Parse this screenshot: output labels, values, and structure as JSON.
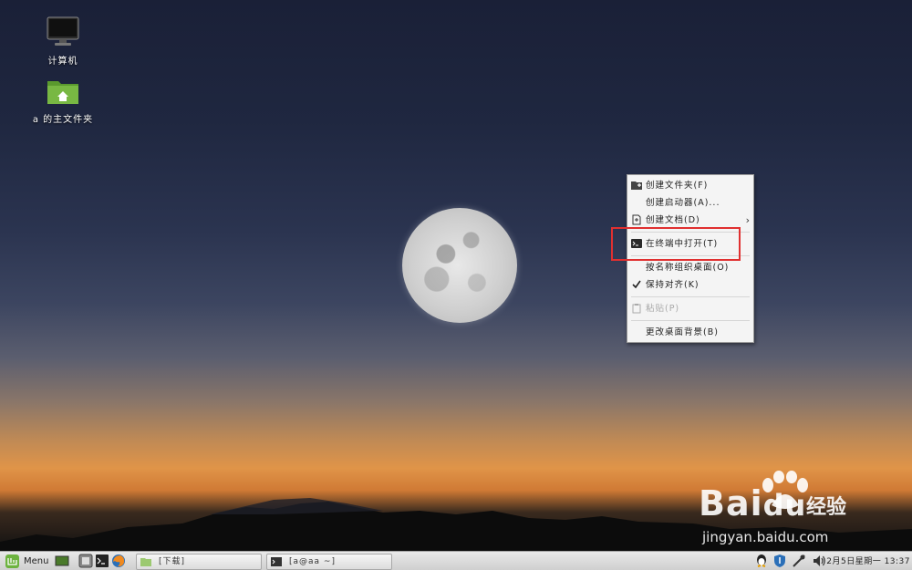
{
  "desktop_icons": [
    {
      "label": "计算机",
      "icon": "computer-icon"
    },
    {
      "label": "a 的主文件夹",
      "icon": "home-folder-icon"
    }
  ],
  "context_menu": {
    "items": [
      {
        "label": "创建文件夹(F)",
        "icon": "folder-new-icon",
        "enabled": true
      },
      {
        "label": "创建启动器(A)...",
        "icon": "",
        "enabled": true
      },
      {
        "label": "创建文档(D)",
        "icon": "document-new-icon",
        "enabled": true,
        "submenu": true
      },
      {
        "label": "在终端中打开(T)",
        "icon": "terminal-icon",
        "enabled": true,
        "highlighted": true
      },
      {
        "label": "按名称组织桌面(O)",
        "icon": "",
        "enabled": true
      },
      {
        "label": "保持对齐(K)",
        "icon": "check-icon",
        "enabled": true,
        "checked": true
      },
      {
        "label": "粘贴(P)",
        "icon": "paste-icon",
        "enabled": false
      },
      {
        "label": "更改桌面背景(B)",
        "icon": "",
        "enabled": true
      }
    ],
    "submenu_arrow": "›",
    "highlight_color": "#e03030"
  },
  "watermark": {
    "brand": "Bai",
    "brand_suffix": "du",
    "cn": "经验",
    "url": "jingyan.baidu.com"
  },
  "taskbar": {
    "menu_label": "Menu",
    "tasks": [
      {
        "label": "[下载]",
        "icon": "folder-icon"
      },
      {
        "label": "[a@aa ~]",
        "icon": "terminal-icon"
      }
    ],
    "clock": "2月5日星期一 13:37"
  },
  "colors": {
    "accent_mint": "#6db33f",
    "menu_bg": "#f4f4f4"
  }
}
